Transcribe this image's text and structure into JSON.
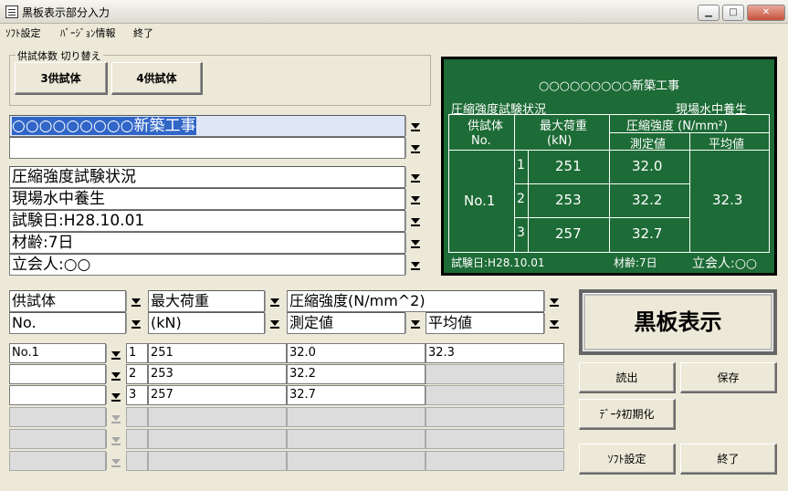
{
  "window": {
    "title": "黒板表示部分入力",
    "minimize": "▁",
    "maximize": "□",
    "close": "✕"
  },
  "menu": [
    "ｿﾌﾄ設定",
    "ﾊﾞｰｼﾞｮﾝ情報",
    "終了"
  ],
  "specimen_switch": {
    "label": "供試体数 切り替え",
    "btn3": "3供試体",
    "btn4": "4供試体"
  },
  "inputs": {
    "project": "○○○○○○○○○新築工事",
    "blank": "",
    "heading": "圧縮強度試験状況",
    "curing": "現場水中養生",
    "test_date": "試験日:H28.10.01",
    "age": "材齢:7日",
    "witness": "立会人:○○"
  },
  "table_headers": {
    "specimen": "供試体",
    "max_load": "最大荷重",
    "strength": "圧縮強度(N/mm^2)",
    "no": "No.",
    "kn": "(kN)",
    "measured": "測定値",
    "average": "平均値"
  },
  "rows": [
    {
      "specimen": "No.1",
      "idx": "1",
      "load": "251",
      "measured": "32.0",
      "average": "32.3"
    },
    {
      "specimen": "",
      "idx": "2",
      "load": "253",
      "measured": "32.2",
      "average": ""
    },
    {
      "specimen": "",
      "idx": "3",
      "load": "257",
      "measured": "32.7",
      "average": ""
    }
  ],
  "board": {
    "title": "○○○○○○○○○新築工事",
    "heading": "圧縮強度試験状況",
    "curing": "現場水中養生",
    "col_specimen": "供試体",
    "col_no": "No.",
    "col_max_load": "最大荷重",
    "col_kn": "(kN)",
    "col_strength": "圧縮強度 (N/mm²)",
    "col_measured": "測定値",
    "col_average": "平均値",
    "specimen_no": "No.1",
    "idx": [
      "1",
      "2",
      "3"
    ],
    "loads": [
      "251",
      "253",
      "257"
    ],
    "measured": [
      "32.0",
      "32.2",
      "32.7"
    ],
    "average": "32.3",
    "test_date": "試験日:H28.10.01",
    "age": "材齢:7日",
    "witness": "立会人:○○"
  },
  "buttons": {
    "show_board": "黒板表示",
    "read": "読出",
    "save": "保存",
    "init": "ﾃﾞｰﾀ初期化",
    "soft_settings": "ｿﾌﾄ設定",
    "exit": "終了"
  }
}
